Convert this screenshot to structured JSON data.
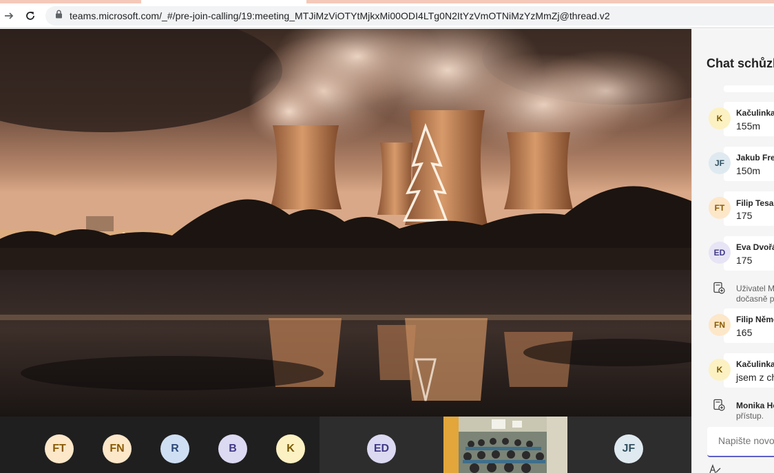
{
  "browser": {
    "url": "teams.microsoft.com/_#/pre-join-calling/19:meeting_MTJiMzViOTYtMjkxMi00ODI4LTg0N2ItYzVmOTNiMzYzMmZj@thread.v2",
    "icons": [
      "forward-arrow-icon",
      "reload-icon",
      "lock-icon"
    ]
  },
  "stage": {
    "description_icon": "shared-content-image"
  },
  "participants": [
    {
      "initials": "FT",
      "bg": "#fde7c9",
      "fg": "#8a5a00"
    },
    {
      "initials": "FN",
      "bg": "#fde7c9",
      "fg": "#8a5a00"
    },
    {
      "initials": "R",
      "bg": "#cfdff3",
      "fg": "#2b4a7a"
    },
    {
      "initials": "B",
      "bg": "#dcd9f2",
      "fg": "#403a88"
    },
    {
      "initials": "K",
      "bg": "#fcf1c2",
      "fg": "#7a5a00"
    },
    {
      "initials": "ED",
      "bg": "#dcd9f2",
      "fg": "#403a88"
    },
    {
      "initials": "JF",
      "bg": "#dfeaf0",
      "fg": "#305060"
    }
  ],
  "chat": {
    "title": "Chat schůzk",
    "messages": [
      {
        "initials": "K",
        "name": "Kačulinka",
        "text": "155m",
        "avatar_bg": "#fcf1c2",
        "avatar_fg": "#7a5a00"
      },
      {
        "initials": "JF",
        "name": "Jakub Frey",
        "text": "150m",
        "avatar_bg": "#dfeaf0",
        "avatar_fg": "#305060"
      },
      {
        "initials": "FT",
        "name": "Filip Tesař",
        "text": "175",
        "avatar_bg": "#fde7c9",
        "avatar_fg": "#8a5a00"
      },
      {
        "initials": "ED",
        "name": "Eva Dvořál",
        "text": "175",
        "avatar_bg": "#e7e4f5",
        "avatar_fg": "#403a88"
      },
      {
        "initials": "FN",
        "name": "Filip Něme",
        "text": "165",
        "avatar_bg": "#fde7c9",
        "avatar_fg": "#8a5a00"
      },
      {
        "initials": "K",
        "name": "Kačulinka",
        "text": "jsem z ch",
        "avatar_bg": "#fcf1c2",
        "avatar_fg": "#7a5a00"
      }
    ],
    "system_1": {
      "line1": "Uživatel M",
      "line2": "dočasně p"
    },
    "system_2": {
      "line1": "Monika Ho",
      "line2": "přístup."
    },
    "compose_placeholder": "Napište novou"
  }
}
